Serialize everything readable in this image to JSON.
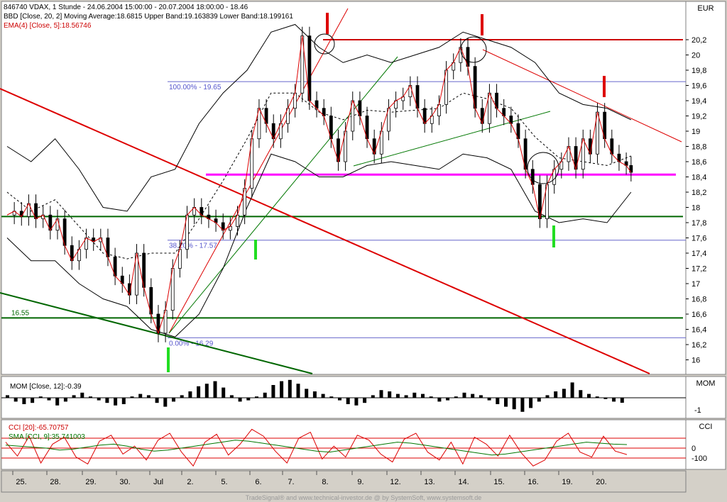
{
  "header": {
    "title": "846740  VDAX, 1 Stunde - 24.06.2004 15:00:00 - 20.07.2004 18:00:00 - 18.46",
    "bbd_legend": "BBD [Close, 20, 2] Moving Average:18.6815 Upper Band:19.163839 Lower Band:18.199161",
    "ema_legend": "EMA(4) [Close, 5]:18.56746"
  },
  "units": {
    "main": "EUR",
    "mom": "MOM",
    "cci": "CCI"
  },
  "chart_data": [
    {
      "type": "candlestick",
      "title": "846740  VDAX, 1 Stunde - 24.06.2004 15:00:00 - 20.07.2004 18:00:00 - 18.46",
      "ylabel": "EUR",
      "ylim": [
        15.8,
        21.0
      ],
      "yticks": [
        "20,2",
        "20",
        "19,8",
        "19,6",
        "19,4",
        "19,2",
        "19",
        "18,8",
        "18,6",
        "18,4",
        "18,2",
        "18",
        "17,8",
        "17,6",
        "17,4",
        "17,2",
        "17",
        "16,8",
        "16,6",
        "16,4",
        "16,2",
        "16"
      ],
      "x_labels": [
        "25.",
        "28.",
        "29.",
        "30.",
        "Jul",
        "2.",
        "5.",
        "6.",
        "7.",
        "8.",
        "9.",
        "12.",
        "13.",
        "14.",
        "15.",
        "16.",
        "19.",
        "20."
      ],
      "close_path": [
        [
          0,
          17.9
        ],
        [
          6,
          17.95
        ],
        [
          12,
          17.88
        ],
        [
          18,
          18.05
        ],
        [
          24,
          17.85
        ],
        [
          30,
          17.9
        ],
        [
          36,
          17.7
        ],
        [
          42,
          17.85
        ],
        [
          48,
          17.5
        ],
        [
          54,
          17.3
        ],
        [
          60,
          17.45
        ],
        [
          66,
          17.6
        ],
        [
          72,
          17.55
        ],
        [
          78,
          17.6
        ],
        [
          84,
          17.35
        ],
        [
          90,
          17.1
        ],
        [
          96,
          17.0
        ],
        [
          102,
          16.85
        ],
        [
          108,
          17.4
        ],
        [
          114,
          16.95
        ],
        [
          120,
          16.6
        ],
        [
          126,
          16.35
        ],
        [
          132,
          16.65
        ],
        [
          138,
          17.2
        ],
        [
          144,
          17.45
        ],
        [
          150,
          17.9
        ],
        [
          156,
          18.0
        ],
        [
          162,
          17.9
        ],
        [
          168,
          17.85
        ],
        [
          174,
          17.8
        ],
        [
          180,
          17.7
        ],
        [
          186,
          17.75
        ],
        [
          192,
          17.9
        ],
        [
          198,
          18.25
        ],
        [
          204,
          18.9
        ],
        [
          210,
          19.3
        ],
        [
          216,
          19.1
        ],
        [
          222,
          18.9
        ],
        [
          228,
          19.1
        ],
        [
          234,
          19.3
        ],
        [
          240,
          19.5
        ],
        [
          246,
          20.25
        ],
        [
          252,
          19.4
        ],
        [
          258,
          19.3
        ],
        [
          264,
          19.2
        ],
        [
          270,
          18.9
        ],
        [
          276,
          18.6
        ],
        [
          282,
          19.0
        ],
        [
          288,
          19.4
        ],
        [
          294,
          19.2
        ],
        [
          300,
          18.9
        ],
        [
          306,
          18.7
        ],
        [
          312,
          19.0
        ],
        [
          318,
          19.3
        ],
        [
          324,
          19.4
        ],
        [
          330,
          19.45
        ],
        [
          336,
          19.6
        ],
        [
          342,
          19.3
        ],
        [
          348,
          19.1
        ],
        [
          354,
          19.2
        ],
        [
          360,
          19.35
        ],
        [
          366,
          19.8
        ],
        [
          372,
          19.9
        ],
        [
          378,
          20.1
        ],
        [
          384,
          19.85
        ],
        [
          390,
          19.3
        ],
        [
          396,
          19.1
        ],
        [
          402,
          19.5
        ],
        [
          408,
          19.3
        ],
        [
          414,
          19.2
        ],
        [
          420,
          19.1
        ],
        [
          426,
          18.9
        ],
        [
          432,
          18.5
        ],
        [
          438,
          18.3
        ],
        [
          444,
          17.85
        ],
        [
          450,
          18.3
        ],
        [
          456,
          18.5
        ],
        [
          462,
          18.6
        ],
        [
          468,
          18.8
        ],
        [
          474,
          18.5
        ],
        [
          480,
          18.9
        ],
        [
          486,
          18.7
        ],
        [
          492,
          19.25
        ],
        [
          498,
          18.9
        ],
        [
          504,
          18.7
        ],
        [
          510,
          18.6
        ],
        [
          516,
          18.55
        ],
        [
          520,
          18.46
        ]
      ],
      "band_upper_path": [
        [
          0,
          18.8
        ],
        [
          20,
          18.6
        ],
        [
          40,
          18.9
        ],
        [
          60,
          18.5
        ],
        [
          80,
          18.0
        ],
        [
          100,
          17.95
        ],
        [
          120,
          18.4
        ],
        [
          140,
          18.5
        ],
        [
          160,
          19.1
        ],
        [
          180,
          19.5
        ],
        [
          200,
          19.8
        ],
        [
          220,
          20.3
        ],
        [
          240,
          20.4
        ],
        [
          260,
          20.1
        ],
        [
          280,
          19.9
        ],
        [
          300,
          20.0
        ],
        [
          320,
          19.9
        ],
        [
          340,
          20.0
        ],
        [
          360,
          20.1
        ],
        [
          380,
          20.3
        ],
        [
          400,
          20.2
        ],
        [
          420,
          20.1
        ],
        [
          440,
          19.9
        ],
        [
          460,
          19.5
        ],
        [
          480,
          19.35
        ],
        [
          500,
          19.3
        ],
        [
          520,
          19.15
        ]
      ],
      "band_lower_path": [
        [
          0,
          17.6
        ],
        [
          20,
          17.3
        ],
        [
          40,
          17.3
        ],
        [
          60,
          17.0
        ],
        [
          80,
          16.8
        ],
        [
          100,
          16.7
        ],
        [
          120,
          16.4
        ],
        [
          140,
          16.3
        ],
        [
          160,
          16.6
        ],
        [
          180,
          17.2
        ],
        [
          200,
          18.0
        ],
        [
          220,
          18.7
        ],
        [
          240,
          18.6
        ],
        [
          260,
          18.4
        ],
        [
          280,
          18.4
        ],
        [
          300,
          18.55
        ],
        [
          320,
          18.6
        ],
        [
          340,
          18.55
        ],
        [
          360,
          18.5
        ],
        [
          380,
          18.7
        ],
        [
          400,
          18.65
        ],
        [
          420,
          18.5
        ],
        [
          440,
          17.95
        ],
        [
          460,
          17.8
        ],
        [
          480,
          17.85
        ],
        [
          500,
          17.8
        ],
        [
          520,
          18.2
        ]
      ],
      "horizontal_lines": [
        {
          "value": 20.2,
          "color": "#cc0000",
          "label": ""
        },
        {
          "value": 18.43,
          "color": "#ff00ff",
          "label": ""
        },
        {
          "value": 17.88,
          "color": "#006600",
          "label": ""
        },
        {
          "value": 16.55,
          "color": "#006600",
          "label": "16.55"
        }
      ],
      "fibonacci": [
        {
          "value": 19.65,
          "label": "100.00% - 19.65"
        },
        {
          "value": 17.57,
          "label": "38.20% - 17.57"
        },
        {
          "value": 16.29,
          "label": "0.00% - 16.29"
        }
      ],
      "signals": [
        {
          "type": "sell",
          "color": "#dd0000"
        },
        {
          "type": "sell",
          "color": "#dd0000"
        },
        {
          "type": "sell",
          "color": "#dd0000"
        },
        {
          "type": "buy",
          "color": "#22dd22"
        },
        {
          "type": "buy",
          "color": "#22dd22"
        },
        {
          "type": "buy",
          "color": "#22dd22"
        }
      ]
    },
    {
      "type": "bar",
      "title": "MOM [Close, 12]:-0.39",
      "ylabel": "MOM",
      "ytick": "-1",
      "values": [
        0.2,
        -0.3,
        -0.5,
        -0.4,
        0.1,
        -0.2,
        -0.6,
        -0.3,
        0.2,
        0.4,
        0.1,
        -0.2,
        -0.4,
        -0.6,
        -0.5,
        0.1,
        0.3,
        0.2,
        -0.4,
        -0.7,
        -0.3,
        0.2,
        0.5,
        0.9,
        1.1,
        1.3,
        0.8,
        0.2,
        -0.3,
        -0.2,
        0.1,
        0.4,
        1.0,
        1.3,
        1.4,
        1.1,
        0.7,
        0.5,
        0.3,
        0.1,
        -0.2,
        -0.5,
        -0.6,
        -0.4,
        0.2,
        0.6,
        0.5,
        0.3,
        0.2,
        0.4,
        0.3,
        0.1,
        -0.3,
        -0.2,
        0.1,
        0.4,
        0.3,
        0.2,
        -0.2,
        -0.5,
        -0.7,
        -0.9,
        -1.1,
        -0.8,
        -0.3,
        0.2,
        0.5,
        0.7,
        1.2,
        0.6,
        0.3,
        0.1,
        -0.1,
        -0.3,
        -0.39
      ]
    },
    {
      "type": "line",
      "title": "CCI [20]:-65.70757",
      "ylabel": "CCI",
      "yticks": [
        "0",
        "-100"
      ],
      "series": [
        {
          "name": "CCI [20]:-65.70757",
          "color": "#dd0000",
          "values": [
            60,
            -80,
            120,
            -150,
            40,
            110,
            -90,
            -160,
            70,
            130,
            -60,
            20,
            -120,
            80,
            150,
            -40,
            -180,
            60,
            140,
            -70,
            40,
            190,
            120,
            -30,
            -150,
            100,
            160,
            -110,
            20,
            -90,
            130,
            80,
            -60,
            -140,
            90,
            150,
            -40,
            -120,
            60,
            -160,
            110,
            40,
            -80,
            130,
            -50,
            -180,
            -120,
            70,
            150,
            -40,
            -90,
            120,
            -30,
            -65
          ]
        },
        {
          "name": "SMA [CCI, 9]:35.741003",
          "color": "#007700",
          "values": [
            30,
            20,
            10,
            0,
            -20,
            -10,
            10,
            30,
            40,
            20,
            -10,
            -30,
            -20,
            0,
            20,
            40,
            60,
            80,
            70,
            50,
            30,
            10,
            -10,
            -30,
            -40,
            -20,
            0,
            20,
            40,
            60,
            50,
            30,
            10,
            -10,
            -30,
            -50,
            -70,
            -60,
            -40,
            -20,
            0,
            20,
            40,
            60,
            50,
            40,
            36
          ]
        }
      ]
    }
  ],
  "footer": {
    "credit": "TradeSignal® and www.technical-investor.de @ by SystemSoft, www.systemsoft.de"
  }
}
